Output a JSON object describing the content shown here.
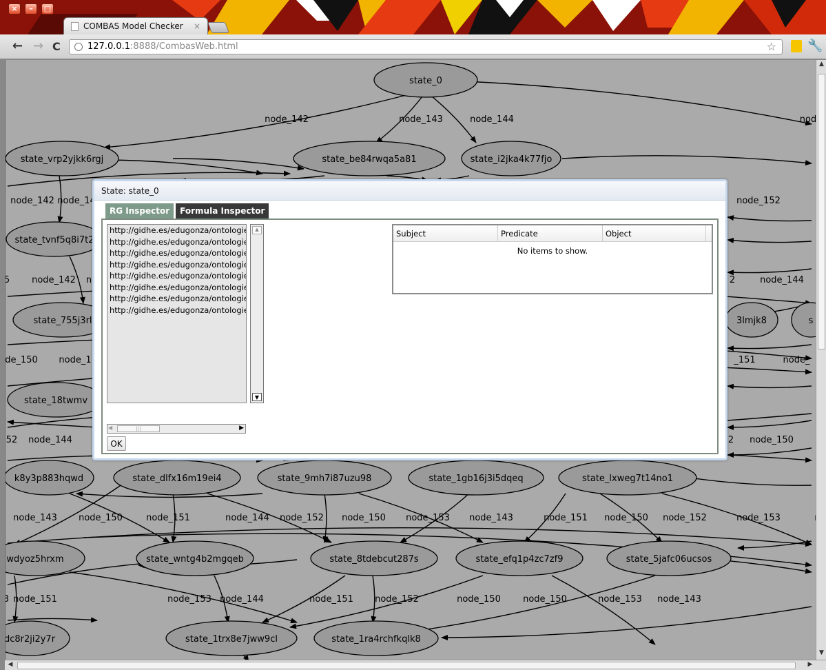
{
  "browser": {
    "tab_title": "COMBAS Model Checker",
    "tab_close": "×",
    "url_host": "127.0.0.1",
    "url_rest": ":8888/CombasWeb.html",
    "back_glyph": "←",
    "forward_glyph": "→",
    "reload_glyph": "C",
    "star_glyph": "☆",
    "wrench_glyph": "🔧",
    "window_close": "×",
    "window_minimize": "–",
    "window_maximize": "□"
  },
  "graph": {
    "node_fill": "#9a9a9a",
    "background": "#aaaaaa",
    "states": [
      {
        "label": "state_0"
      },
      {
        "label": "state_vrp2yjkk6rgj"
      },
      {
        "label": "state_be84rwqa5a81"
      },
      {
        "label": "state_i2jka4k77fjo"
      },
      {
        "label": "state_tvnf5q8i7t2"
      },
      {
        "label": "state_755j3rl"
      },
      {
        "label": "state_18twmv"
      },
      {
        "label": "3lmjk8"
      },
      {
        "label": "s"
      },
      {
        "label": "k8y3p883hqwd"
      },
      {
        "label": "state_dlfx16m19ei4"
      },
      {
        "label": "state_9mh7i87uzu98"
      },
      {
        "label": "state_1gb16j3i5dqeq"
      },
      {
        "label": "state_lxweg7t14no1"
      },
      {
        "label": "wdyoz5hrxm"
      },
      {
        "label": "state_wntg4b2mgqeb"
      },
      {
        "label": "state_8tdebcut287s"
      },
      {
        "label": "state_efq1p4zc7zf9"
      },
      {
        "label": "state_5jafc06ucsos"
      },
      {
        "label": "dc8r2ji2y7r"
      },
      {
        "label": "state_1trx8e7jww9cl"
      },
      {
        "label": "state_1ra4rchfkqlk8"
      }
    ],
    "edge_labels": [
      {
        "label": "node_142"
      },
      {
        "label": "node_143"
      },
      {
        "label": "node_144"
      },
      {
        "label": "nod"
      },
      {
        "label": "node_142"
      },
      {
        "label": "node_14"
      },
      {
        "label": "node_152"
      },
      {
        "label": "node_142"
      },
      {
        "label": "no"
      },
      {
        "label": "2"
      },
      {
        "label": "node_144"
      },
      {
        "label": "de_150"
      },
      {
        "label": "node_1"
      },
      {
        "label": "_151"
      },
      {
        "label": "node_"
      },
      {
        "label": "52"
      },
      {
        "label": "node_144"
      },
      {
        "label": "2"
      },
      {
        "label": "node_150"
      },
      {
        "label": "node_143"
      },
      {
        "label": "node_150"
      },
      {
        "label": "node_151"
      },
      {
        "label": "node_144"
      },
      {
        "label": "node_152"
      },
      {
        "label": "node_150"
      },
      {
        "label": "node_153"
      },
      {
        "label": "node_143"
      },
      {
        "label": "node_151"
      },
      {
        "label": "node_150"
      },
      {
        "label": "node_152"
      },
      {
        "label": "node_153"
      },
      {
        "label": "nc"
      },
      {
        "label": "node_151"
      },
      {
        "label": "node_153"
      },
      {
        "label": "node_144"
      },
      {
        "label": "node_151"
      },
      {
        "label": "node_152"
      },
      {
        "label": "node_150"
      },
      {
        "label": "node_150"
      },
      {
        "label": "node_153"
      },
      {
        "label": "node_143"
      },
      {
        "label": "3"
      },
      {
        "label": "5"
      }
    ]
  },
  "dialog": {
    "title": "State: state_0",
    "tabs": [
      {
        "label": "RG Inspector",
        "active": true
      },
      {
        "label": "Formula Inspector",
        "active": false
      }
    ],
    "uri_items": [
      "http://gidhe.es/edugonza/ontologie",
      "http://gidhe.es/edugonza/ontologie",
      "http://gidhe.es/edugonza/ontologie",
      "http://gidhe.es/edugonza/ontologie",
      "http://gidhe.es/edugonza/ontologie",
      "http://gidhe.es/edugonza/ontologie",
      "http://gidhe.es/edugonza/ontologie",
      "http://gidhe.es/edugonza/ontologie"
    ],
    "ok_label": "OK",
    "triples_table": {
      "columns": [
        "Subject",
        "Predicate",
        "Object"
      ],
      "empty_text": "No items to show."
    },
    "accent_color": "#7e9a8a"
  }
}
